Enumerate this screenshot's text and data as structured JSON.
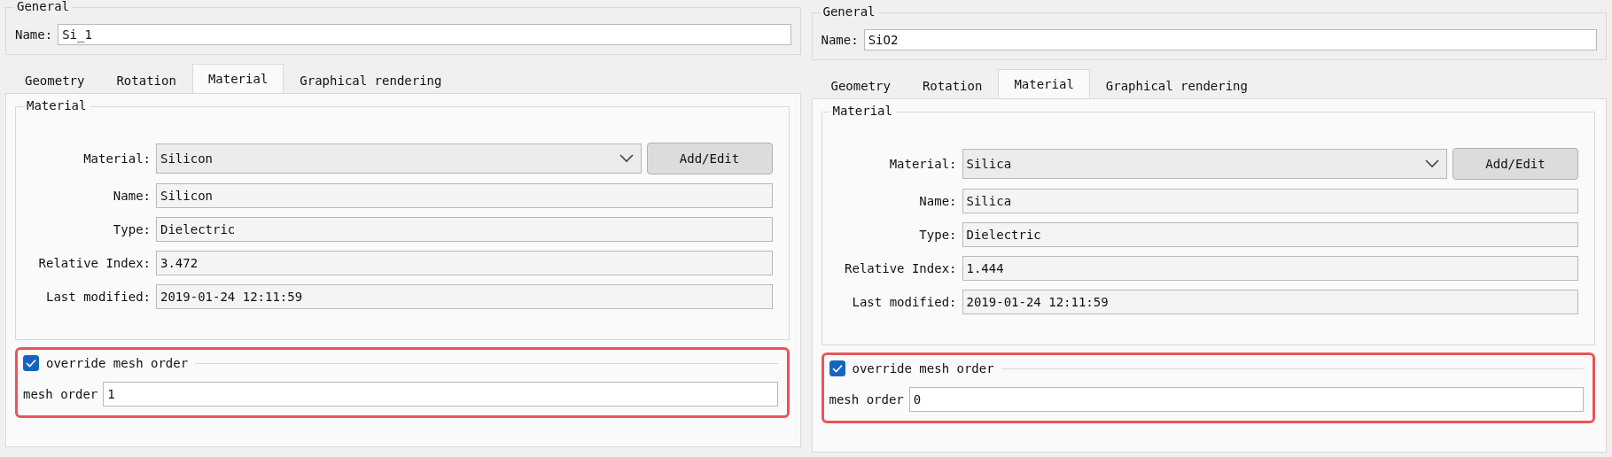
{
  "panels": [
    {
      "general": {
        "title": "General",
        "name_label": "Name:",
        "name": "Si_1"
      },
      "tabs": [
        {
          "label": "Geometry",
          "selected": false
        },
        {
          "label": "Rotation",
          "selected": false
        },
        {
          "label": "Material",
          "selected": true
        },
        {
          "label": "Graphical rendering",
          "selected": false
        }
      ],
      "material": {
        "title": "Material",
        "dropdown_label": "Material:",
        "dropdown_value": "Silicon",
        "button": "Add/Edit",
        "fields": [
          {
            "label": "Name:",
            "value": "Silicon"
          },
          {
            "label": "Type:",
            "value": "Dielectric"
          },
          {
            "label": "Relative Index:",
            "value": "3.472"
          },
          {
            "label": "Last modified:",
            "value": "2019-01-24 12:11:59"
          }
        ]
      },
      "override": {
        "label": "override mesh order",
        "checked": true,
        "highlighted": true,
        "field_label": "mesh order",
        "value": "1"
      }
    },
    {
      "general": {
        "title": "General",
        "name_label": "Name:",
        "name": "SiO2"
      },
      "tabs": [
        {
          "label": "Geometry",
          "selected": false
        },
        {
          "label": "Rotation",
          "selected": false
        },
        {
          "label": "Material",
          "selected": true
        },
        {
          "label": "Graphical rendering",
          "selected": false
        }
      ],
      "material": {
        "title": "Material",
        "dropdown_label": "Material:",
        "dropdown_value": "Silica",
        "button": "Add/Edit",
        "fields": [
          {
            "label": "Name:",
            "value": "Silica"
          },
          {
            "label": "Type:",
            "value": "Dielectric"
          },
          {
            "label": "Relative Index:",
            "value": "1.444"
          },
          {
            "label": "Last modified:",
            "value": "2019-01-24 12:11:59"
          }
        ]
      },
      "override": {
        "label": "override mesh order",
        "checked": true,
        "highlighted": true,
        "field_label": "mesh order",
        "value": "0"
      }
    }
  ]
}
